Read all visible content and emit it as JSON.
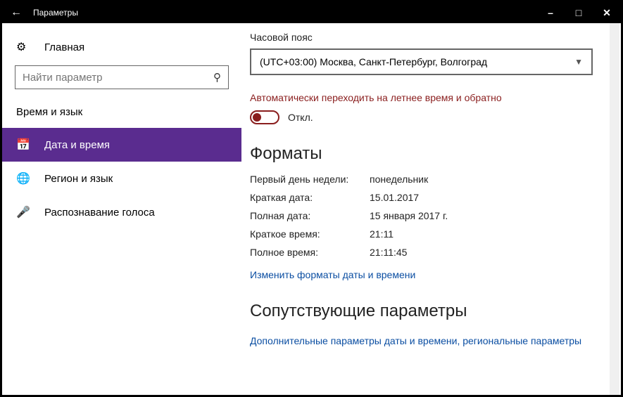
{
  "titlebar": {
    "title": "Параметры"
  },
  "sidebar": {
    "home": "Главная",
    "search_placeholder": "Найти параметр",
    "group": "Время и язык",
    "items": [
      {
        "label": "Дата и время"
      },
      {
        "label": "Регион и язык"
      },
      {
        "label": "Распознавание голоса"
      }
    ]
  },
  "content": {
    "timezone_label": "Часовой пояс",
    "timezone_value": "(UTC+03:00) Москва, Санкт-Петербург, Волгоград",
    "dst_label": "Автоматически переходить на летнее время и обратно",
    "dst_state": "Откл.",
    "formats_heading": "Форматы",
    "formats": [
      {
        "k": "Первый день недели:",
        "v": "понедельник"
      },
      {
        "k": "Краткая дата:",
        "v": "15.01.2017"
      },
      {
        "k": "Полная дата:",
        "v": "15 января 2017 г."
      },
      {
        "k": "Краткое время:",
        "v": "21:11"
      },
      {
        "k": "Полное время:",
        "v": "21:11:45"
      }
    ],
    "change_formats_link": "Изменить форматы даты и времени",
    "related_heading": "Сопутствующие параметры",
    "related_link": "Дополнительные параметры даты и времени, региональные параметры"
  }
}
